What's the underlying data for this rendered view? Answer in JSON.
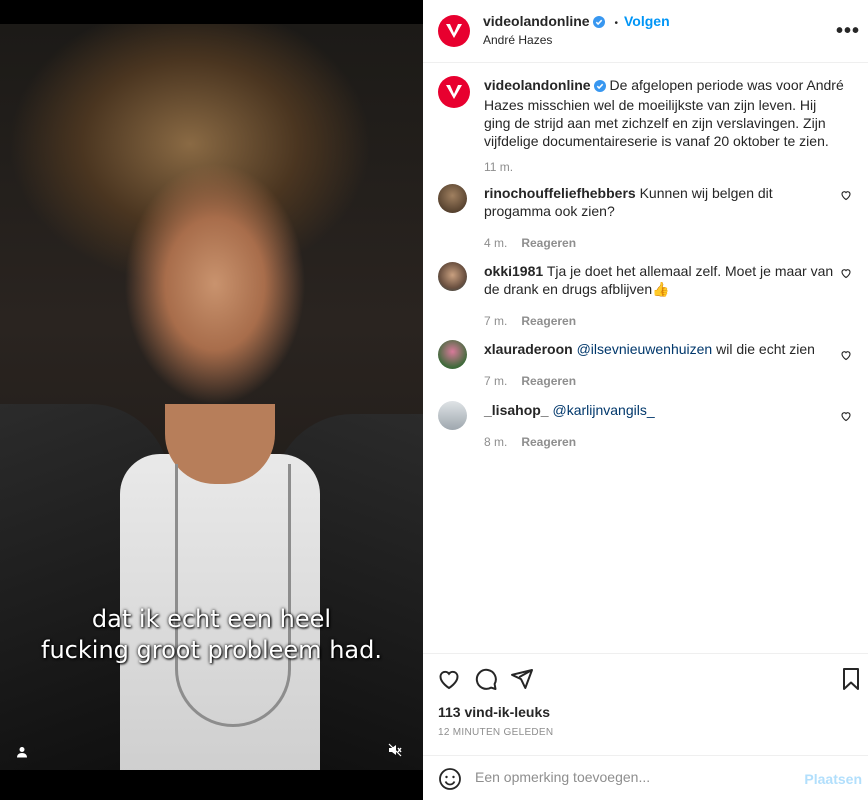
{
  "media": {
    "subtitle_line1": "dat ik echt een heel",
    "subtitle_line2": "fucking groot probleem had."
  },
  "header": {
    "username": "videolandonline",
    "separator": "•",
    "follow_label": "Volgen",
    "subtitle": "André Hazes",
    "more_label": "•••"
  },
  "caption": {
    "username": "videolandonline",
    "text": "De afgelopen periode was voor André Hazes misschien wel de moeilijkste van zijn leven. Hij ging de strijd aan met zichzelf en zijn verslavingen. Zijn vijfdelige documentaireserie is vanaf 20 oktober te zien.",
    "time": "11 m."
  },
  "comments": [
    {
      "username": "rinochouffeliefhebbers",
      "text": "Kunnen wij belgen dit progamma ook zien?",
      "time": "4 m.",
      "reply": "Reageren"
    },
    {
      "username": "okki1981",
      "text": "Tja je doet het allemaal zelf. Moet je maar van de drank en drugs afblijven👍",
      "time": "7 m.",
      "reply": "Reageren"
    },
    {
      "username": "xlauraderoon",
      "mention": "@ilsevnieuwenhuizen",
      "text": " wil die echt zien",
      "time": "7 m.",
      "reply": "Reageren"
    },
    {
      "username": "_lisahop_",
      "mention": "@karlijnvangils_",
      "text": "",
      "time": "8 m.",
      "reply": "Reageren"
    }
  ],
  "footer": {
    "likes": "113 vind-ik-leuks",
    "time": "12 MINUTEN GELEDEN",
    "comment_placeholder": "Een opmerking toevoegen...",
    "post_label": "Plaatsen"
  },
  "colors": {
    "brand": "#e8002f",
    "link": "#0095f6",
    "verified": "#3897f0"
  }
}
